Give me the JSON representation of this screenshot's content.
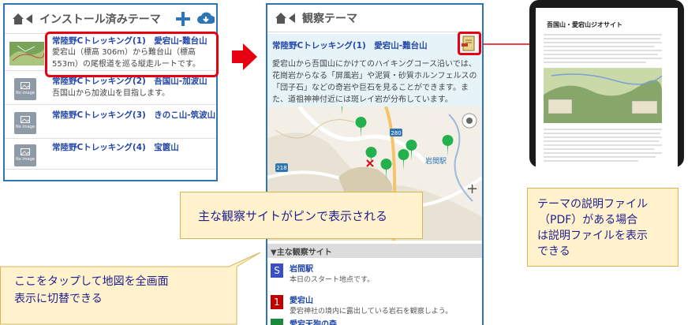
{
  "panel1": {
    "title": "インストール済みテーマ",
    "items": [
      {
        "title": "常陸野Cトレッキング(1)　愛宕山-難台山",
        "desc": "愛宕山（標高 306m）から難台山（標高 553m）の尾根道を巡る縦走ルートです。"
      },
      {
        "title": "常陸野Cトレッキング(2)　吾国山-加波山",
        "desc": "吾国山から加波山を目指します。"
      },
      {
        "title": "常陸野Cトレッキング(3)　きのこ山-筑波山",
        "desc": ""
      },
      {
        "title": "常陸野Cトレッキング(4)　宝篋山",
        "desc": ""
      }
    ],
    "noimage_label": "No image"
  },
  "panel2": {
    "title": "観察テーマ",
    "theme_title": "常陸野Cトレッキング(1)　愛宕山-難台山",
    "description": "愛宕山から吾国山にかけてのハイキングコース沿いでは、花崗岩からなる「屏風岩」や泥質・砂質ホルンフェルスの「団子石」などの奇岩や巨石を見ることができます。また、道祖神神付近には斑レイ岩が分布しています。",
    "map_labels": {
      "station": "岩間駅",
      "road1": "280",
      "road2": "218",
      "road3": "15"
    },
    "section_label": "▼主な観察サイト",
    "sites": [
      {
        "badge": "S",
        "name": "岩間駅",
        "desc": "本日のスタート地点です。",
        "color": "#3a4fc4"
      },
      {
        "badge": "1",
        "name": "愛宕山",
        "desc": "愛宕神社の境内に露出している岩石を観察しよう。",
        "color": "#c00000"
      },
      {
        "badge": "",
        "name": "愛宕天狗の森",
        "desc": "",
        "color": "#1a8a3a"
      }
    ]
  },
  "panel3": {
    "doc_title": "吾国山・愛宕山ジオサイト"
  },
  "callouts": {
    "pins": "主な観察サイトがピンで表示される",
    "tap": "ここをタップして地図を全画面\n表示に切替できる",
    "pdf": "テーマの説明ファイル（PDF）がある場合は説明ファイルを表示できる",
    "pdf_lines": [
      "テーマの説明ファイル",
      "（PDF）がある場合",
      "は説明ファイルを表示",
      "できる"
    ],
    "tap_lines": [
      "ここをタップして地図を全画面",
      "表示に切替できる"
    ]
  },
  "colors": {
    "accent": "#2e75b6",
    "title_blue": "#2246a8",
    "highlight_red": "#e60012",
    "callout_bg": "#fff2cc",
    "pin_green": "#22b14c"
  }
}
